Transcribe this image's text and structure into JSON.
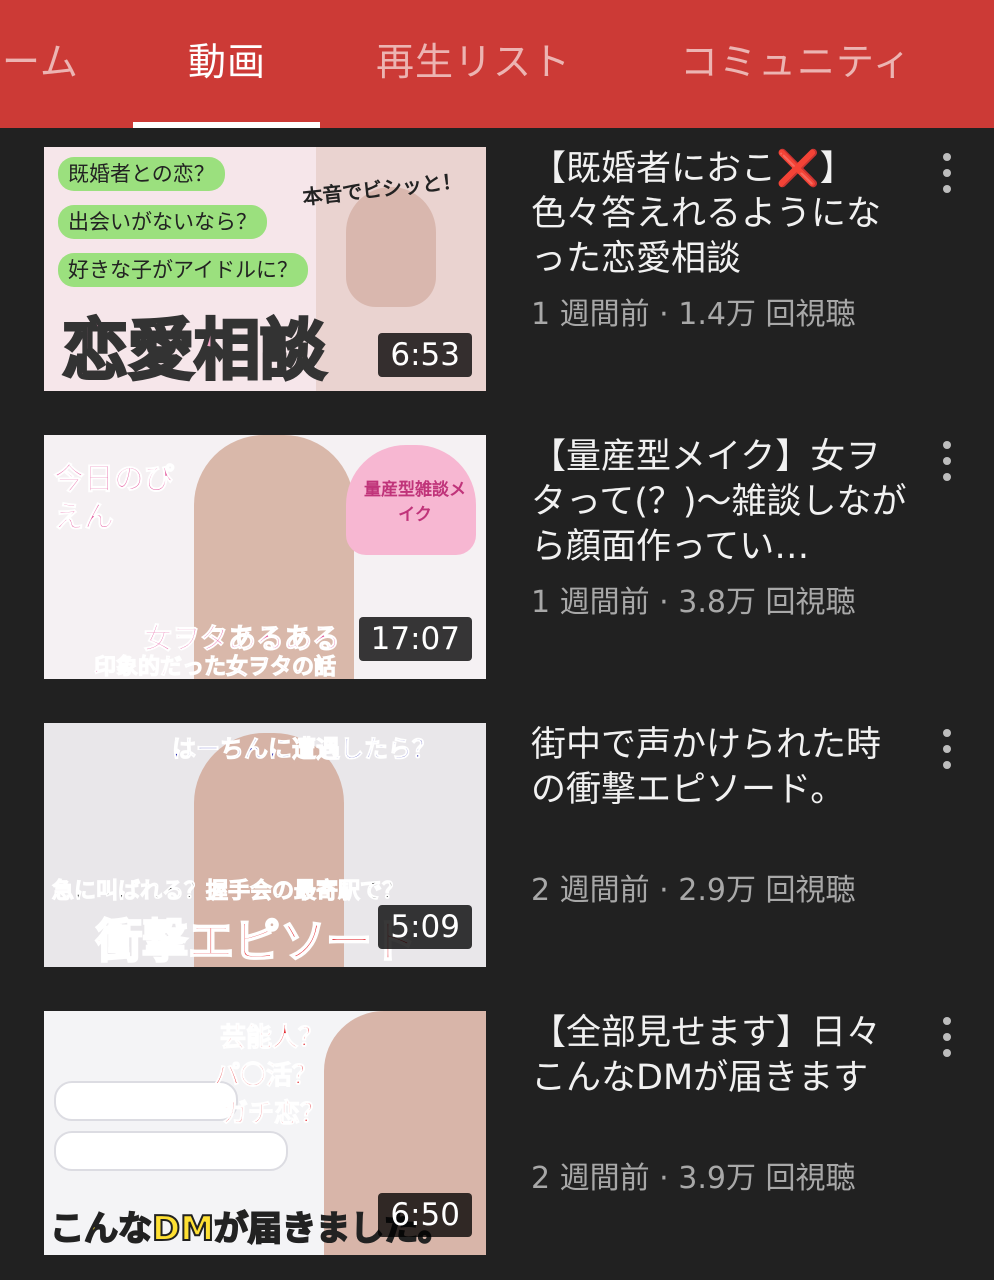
{
  "tabs": [
    {
      "label": "ーム"
    },
    {
      "label": "動画"
    },
    {
      "label": "再生リスト"
    },
    {
      "label": "コミュニティ"
    }
  ],
  "videos": [
    {
      "title": "【既婚者におこ❌】色々答えれるようになった恋愛相談",
      "meta": "1 週間前 · 1.4万 回視聴",
      "duration": "6:53",
      "thumb": {
        "chip1": "既婚者との恋？",
        "chip2": "出会いがないなら？",
        "chip3": "好きな子がアイドルに？",
        "corner": "本音でビシッと！",
        "headline": "恋愛相談"
      }
    },
    {
      "title": "【量産型メイク】女ヲタって(？)〜雑談しながら顔面作ってい…",
      "meta": "1 週間前 · 3.8万 回視聴",
      "duration": "17:07",
      "thumb": {
        "badge": "今日のぴえん",
        "heart": "量産型雑談メイク",
        "line1": "女ヲタあるある",
        "line2": "印象的だった女ヲタの話"
      }
    },
    {
      "title": "街中で声かけられた時の衝撃エピソード。",
      "meta": "2 週間前 · 2.9万 回視聴",
      "duration": "5:09",
      "thumb": {
        "top": "はーちんに遭遇したら？",
        "mid": "急に叫ばれる？握手会の最寄駅で？",
        "headline": "衝撃エピソード"
      }
    },
    {
      "title": "【全部見せます】日々こんなDMが届きます",
      "meta": "2 週間前 · 3.9万 回視聴",
      "duration": "6:50",
      "thumb": {
        "q1": "芸能人？",
        "q2": "パ〇活？",
        "q3": "ガチ恋？",
        "headline": "こんなDMが届きました。"
      }
    }
  ],
  "colors": {
    "header": "#cc3a36",
    "background": "#212121",
    "title_text": "#f1f1f1",
    "meta_text": "#a8a8a8"
  },
  "icons": {
    "more": "more-vert-icon"
  }
}
